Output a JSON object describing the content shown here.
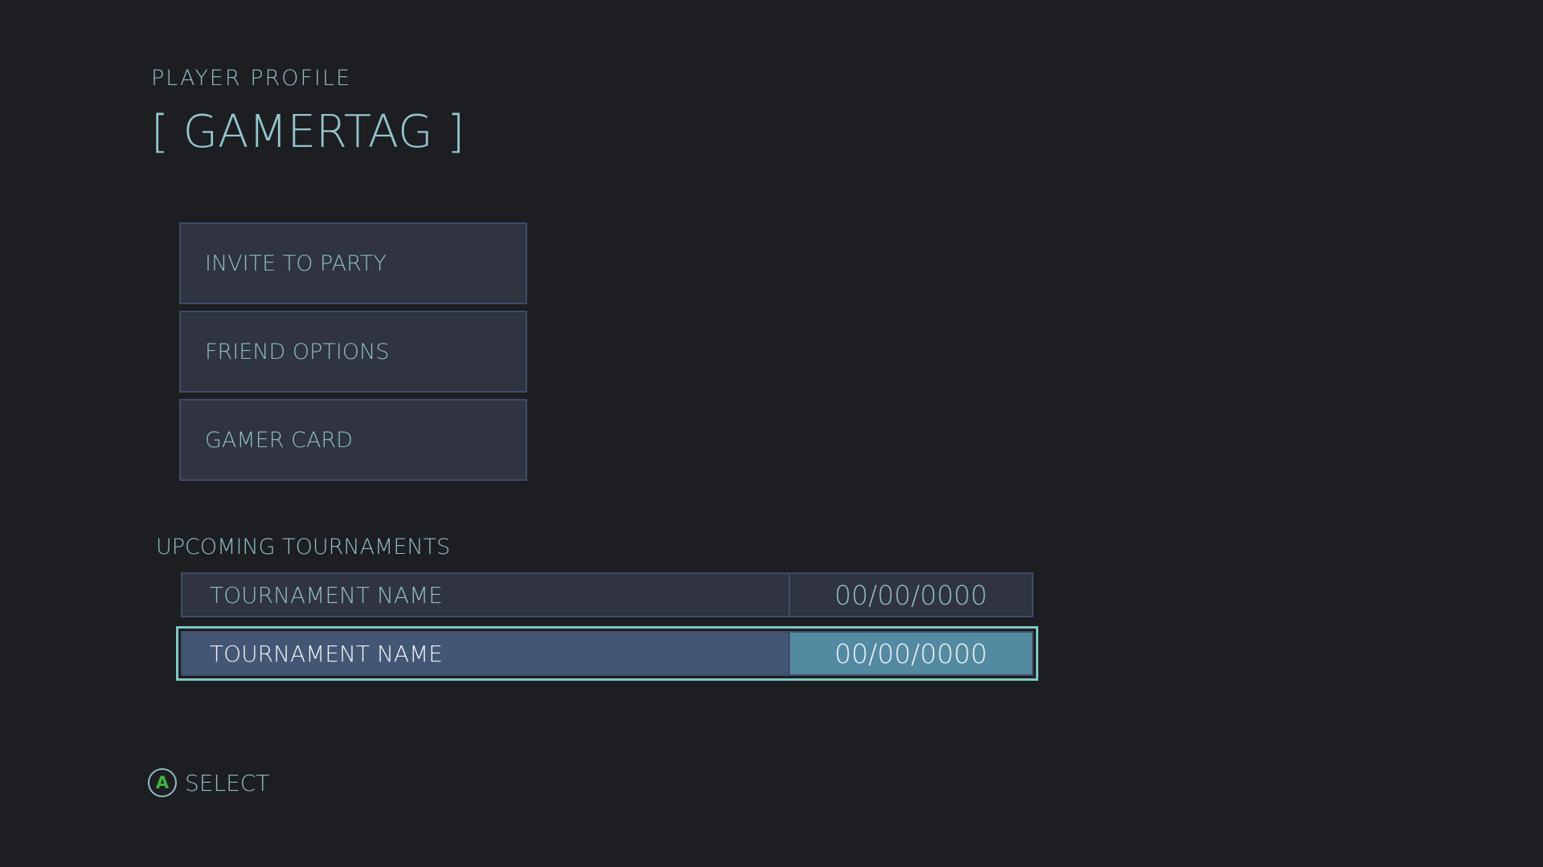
{
  "header": {
    "subtitle": "PLAYER PROFILE",
    "title": "[ GAMERTAG ]"
  },
  "menu": {
    "items": [
      {
        "label": "INVITE TO PARTY"
      },
      {
        "label": "FRIEND OPTIONS"
      },
      {
        "label": "GAMER CARD"
      }
    ]
  },
  "tournaments": {
    "heading": "UPCOMING TOURNAMENTS",
    "rows": [
      {
        "name": "TOURNAMENT NAME",
        "date": "00/00/0000",
        "selected": false
      },
      {
        "name": "TOURNAMENT NAME",
        "date": "00/00/0000",
        "selected": true
      }
    ]
  },
  "footer": {
    "button_glyph": "A",
    "action_label": "SELECT"
  },
  "colors": {
    "background": "#1d1e22",
    "text": "#8fbdc2",
    "panel": "#2f3440",
    "selected_row": "#435674",
    "selected_date": "#5489a2",
    "focus_outline": "#7dc8c4",
    "a_button": "#3fb540"
  },
  "icons": {
    "a_button": "a-button-icon"
  }
}
